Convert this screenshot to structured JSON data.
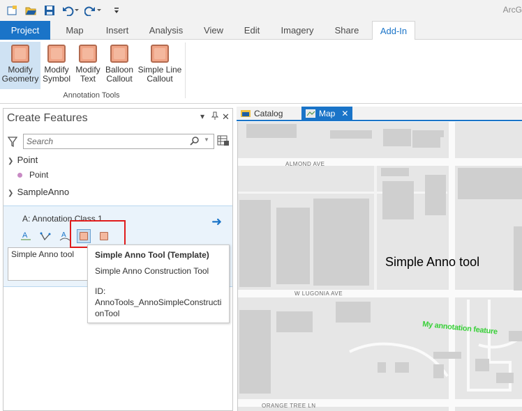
{
  "app": {
    "title_fragment": "ArcG"
  },
  "quick_access": [
    "new-icon",
    "open-icon",
    "save-icon",
    "undo-icon",
    "redo-icon",
    "customize-icon"
  ],
  "ribbon": {
    "tabs": [
      {
        "label": "Project"
      },
      {
        "label": "Map"
      },
      {
        "label": "Insert"
      },
      {
        "label": "Analysis"
      },
      {
        "label": "View"
      },
      {
        "label": "Edit"
      },
      {
        "label": "Imagery"
      },
      {
        "label": "Share"
      },
      {
        "label": "Add-In"
      }
    ],
    "active_tab": "Add-In",
    "buttons": [
      {
        "line1": "Modify",
        "line2": "Geometry"
      },
      {
        "line1": "Modify",
        "line2": "Symbol"
      },
      {
        "line1": "Modify",
        "line2": "Text"
      },
      {
        "line1": "Balloon",
        "line2": "Callout"
      },
      {
        "line1": "Simple Line",
        "line2": "Callout"
      }
    ],
    "group_label": "Annotation Tools"
  },
  "create_features": {
    "title": "Create Features",
    "search_placeholder": "Search",
    "groups": [
      {
        "name": "Point",
        "items": [
          "Point"
        ]
      },
      {
        "name": "SampleAnno"
      }
    ],
    "template": {
      "name": "A: Annotation Class 1",
      "description": "Simple Anno tool"
    }
  },
  "tooltip": {
    "title": "Simple Anno Tool (Template)",
    "description": "Simple Anno Construction Tool",
    "id_label": "ID:",
    "id_value": "AnnoTools_AnnoSimpleConstructionTool"
  },
  "doc_tabs": [
    {
      "label": "Catalog"
    },
    {
      "label": "Map"
    }
  ],
  "map": {
    "streets": [
      "ALMOND AVE",
      "W LUGONIA AVE",
      "ORANGE TREE LN"
    ],
    "annotation_text": "Simple Anno tool",
    "annotation_feature": "My annotation feature",
    "feature_color": "#3ad03a"
  },
  "colors": {
    "accent": "#1a74c8",
    "highlight": "#e01b1b"
  }
}
